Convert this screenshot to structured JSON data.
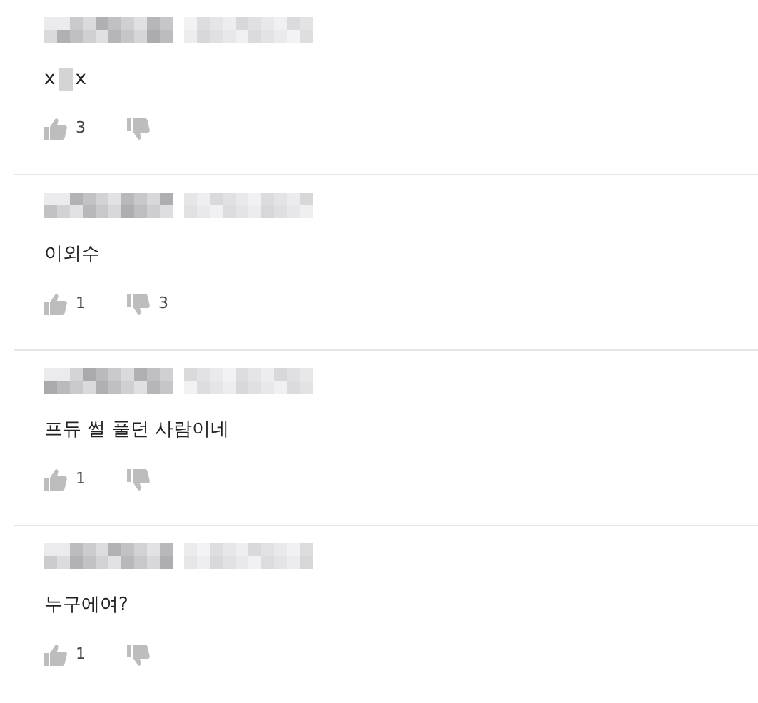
{
  "comments": [
    {
      "text_parts": [
        "x",
        "x"
      ],
      "likes": "3"
    },
    {
      "text_parts": [
        "이외수"
      ],
      "likes": "1",
      "dislikes": "3"
    },
    {
      "text_parts": [
        "프듀 썰 풀던 사람이네"
      ],
      "likes": "1"
    },
    {
      "text_parts": [
        "누구에여?"
      ],
      "likes": "1"
    }
  ]
}
